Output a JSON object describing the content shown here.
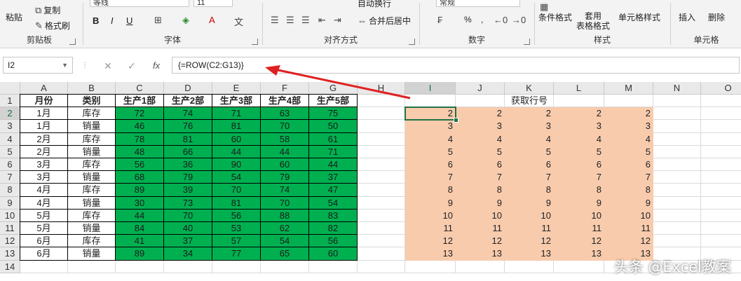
{
  "ribbon": {
    "clipboard": {
      "paste": "粘贴",
      "copy": "复制",
      "format_painter": "格式刷",
      "label": "剪贴板"
    },
    "font": {
      "name": "等线",
      "size": "11",
      "bold": "B",
      "italic": "I",
      "underline": "U",
      "label": "字体"
    },
    "alignment": {
      "wrap": "自动换行",
      "merge": "合并后居中",
      "label": "对齐方式"
    },
    "number": {
      "format": "常规",
      "percent": "%",
      "comma": ",",
      "label": "数字"
    },
    "styles": {
      "conditional": "条件格式",
      "table": "套用\n表格格式",
      "cell_styles": "单元格样式",
      "label": "样式"
    },
    "cells": {
      "insert": "插入",
      "delete": "删除",
      "label": "单元格"
    }
  },
  "formula_bar": {
    "name_box": "I2",
    "formula": "{=ROW(C2:G13)}",
    "fx": "fx"
  },
  "columns": [
    "A",
    "B",
    "C",
    "D",
    "E",
    "F",
    "G",
    "H",
    "I",
    "J",
    "K",
    "L",
    "M",
    "N",
    "O"
  ],
  "rows": [
    "1",
    "2",
    "3",
    "4",
    "5",
    "6",
    "7",
    "8",
    "9",
    "10",
    "11",
    "12",
    "13",
    "14"
  ],
  "table": {
    "headers": [
      "月份",
      "类别",
      "生产1部",
      "生产2部",
      "生产3部",
      "生产4部",
      "生产5部"
    ],
    "data": [
      [
        "1月",
        "库存",
        "72",
        "74",
        "71",
        "63",
        "75"
      ],
      [
        "1月",
        "销量",
        "46",
        "76",
        "81",
        "70",
        "50"
      ],
      [
        "2月",
        "库存",
        "78",
        "81",
        "60",
        "58",
        "61"
      ],
      [
        "2月",
        "销量",
        "48",
        "66",
        "44",
        "44",
        "71"
      ],
      [
        "3月",
        "库存",
        "56",
        "36",
        "90",
        "60",
        "44"
      ],
      [
        "3月",
        "销量",
        "68",
        "79",
        "54",
        "79",
        "37"
      ],
      [
        "4月",
        "库存",
        "89",
        "39",
        "70",
        "74",
        "47"
      ],
      [
        "4月",
        "销量",
        "30",
        "73",
        "81",
        "70",
        "54"
      ],
      [
        "5月",
        "库存",
        "44",
        "70",
        "56",
        "88",
        "83"
      ],
      [
        "5月",
        "销量",
        "84",
        "40",
        "53",
        "62",
        "82"
      ],
      [
        "6月",
        "库存",
        "41",
        "37",
        "57",
        "54",
        "56"
      ],
      [
        "6月",
        "销量",
        "89",
        "34",
        "77",
        "65",
        "60"
      ]
    ]
  },
  "result": {
    "title": "获取行号",
    "rows": [
      [
        "2",
        "2",
        "2",
        "2",
        "2"
      ],
      [
        "3",
        "3",
        "3",
        "3",
        "3"
      ],
      [
        "4",
        "4",
        "4",
        "4",
        "4"
      ],
      [
        "5",
        "5",
        "5",
        "5",
        "5"
      ],
      [
        "6",
        "6",
        "6",
        "6",
        "6"
      ],
      [
        "7",
        "7",
        "7",
        "7",
        "7"
      ],
      [
        "8",
        "8",
        "8",
        "8",
        "8"
      ],
      [
        "9",
        "9",
        "9",
        "9",
        "9"
      ],
      [
        "10",
        "10",
        "10",
        "10",
        "10"
      ],
      [
        "11",
        "11",
        "11",
        "11",
        "11"
      ],
      [
        "12",
        "12",
        "12",
        "12",
        "12"
      ],
      [
        "13",
        "13",
        "13",
        "13",
        "13"
      ]
    ]
  },
  "watermark": "头条 @Excel教案",
  "colors": {
    "table_fill": "#00b050",
    "result_fill": "#f8cbad",
    "arrow": "#e02020",
    "selection": "#217346"
  }
}
